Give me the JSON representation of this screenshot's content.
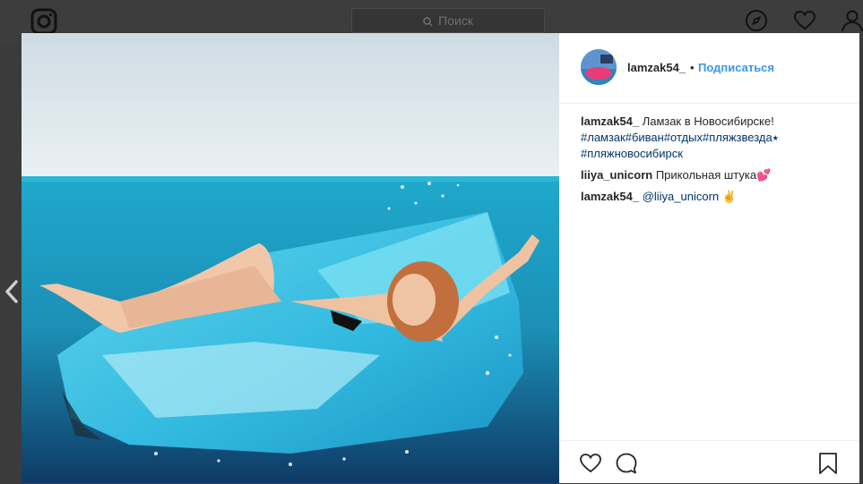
{
  "nav": {
    "search_placeholder": "Поиск",
    "icons": [
      "instagram-logo",
      "search-icon",
      "explore-compass-icon",
      "heart-icon",
      "profile-icon"
    ]
  },
  "post": {
    "author": "lamzak54_",
    "separator": "•",
    "follow_label": "Подписаться",
    "caption": {
      "user": "lamzak54_",
      "text": "Ламзак в Новосибирске!",
      "hashtags": [
        "#ламзак",
        "#биван",
        "#отдых",
        "#пляжзвезда",
        "#пляжновосибирск"
      ],
      "hashtag_star": "⭑"
    },
    "comments": [
      {
        "user": "liiya_unicorn",
        "text": "Прикольная штука",
        "emoji": "💕"
      },
      {
        "user": "lamzak54_",
        "mention": "@liiya_unicorn",
        "emoji": "✌"
      }
    ]
  },
  "colors": {
    "link": "#3897f0",
    "hashtag": "#003569",
    "text": "#262626",
    "dim": "#3b3b3b"
  }
}
